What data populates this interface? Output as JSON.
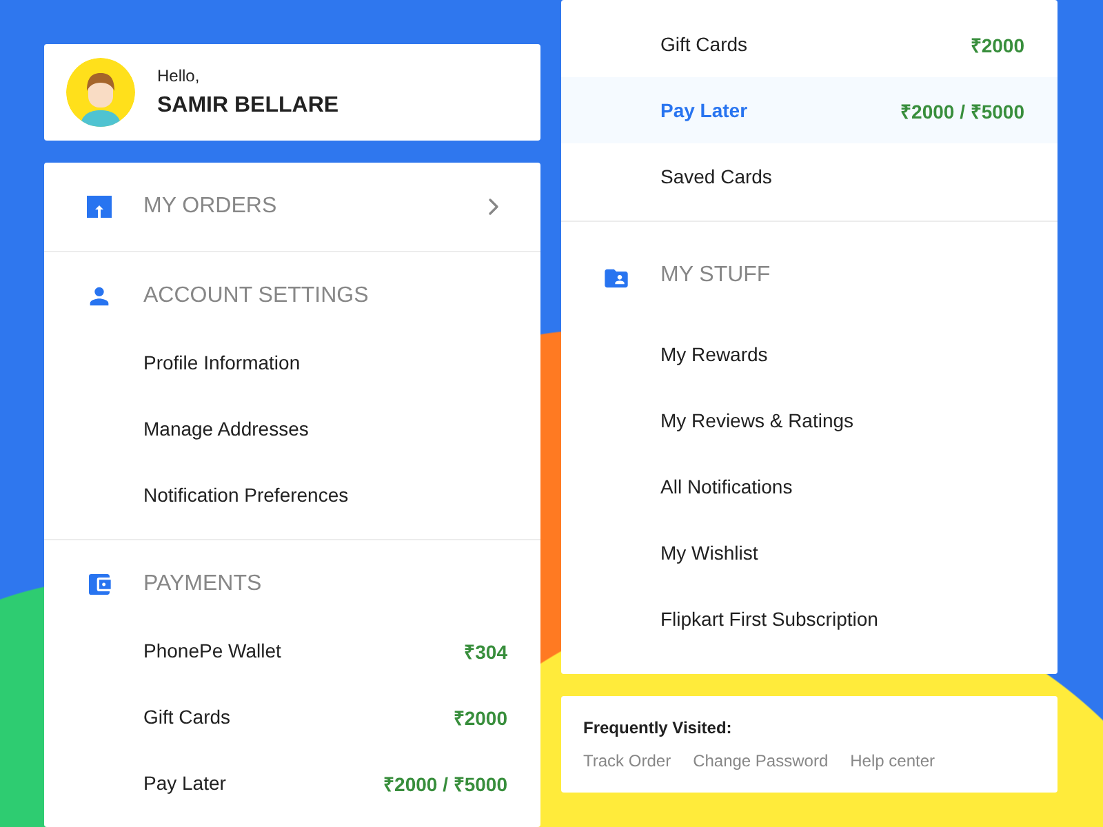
{
  "profile": {
    "greeting": "Hello,",
    "name": "SAMIR BELLARE"
  },
  "left_panel": {
    "sections": [
      {
        "kind": "orders",
        "title": "MY ORDERS"
      },
      {
        "kind": "account",
        "title": "ACCOUNT SETTINGS",
        "items": [
          {
            "label": "Profile Information",
            "selected": false
          },
          {
            "label": "Manage Addresses",
            "selected": false
          },
          {
            "label": "Notification Preferences",
            "selected": false
          }
        ]
      },
      {
        "kind": "payments",
        "title": "PAYMENTS",
        "items": [
          {
            "label": "PhonePe Wallet",
            "value": "₹304",
            "selected": false
          },
          {
            "label": "Gift Cards",
            "value": "₹2000",
            "selected": false
          },
          {
            "label": "Pay Later",
            "value": "₹2000 / ₹5000",
            "selected": false
          }
        ]
      }
    ]
  },
  "right_panel": {
    "sections": [
      {
        "kind": "continued",
        "items": [
          {
            "label": "Gift Cards",
            "value": "₹2000",
            "selected": false
          },
          {
            "label": "Pay Later",
            "value": "₹2000 / ₹5000",
            "selected": true
          },
          {
            "label": "Saved Cards",
            "selected": false
          }
        ]
      },
      {
        "kind": "stuff",
        "title": "MY STUFF",
        "items": [
          {
            "label": "My Rewards",
            "selected": false
          },
          {
            "label": "My Reviews & Ratings",
            "selected": false
          },
          {
            "label": "All Notifications",
            "selected": false
          },
          {
            "label": "My Wishlist",
            "selected": false
          },
          {
            "label": "Flipkart First Subscription",
            "selected": false
          }
        ]
      }
    ]
  },
  "frequently_visited": {
    "title": "Frequently Visited:",
    "links": [
      "Track Order",
      "Change Password",
      "Help center"
    ]
  }
}
